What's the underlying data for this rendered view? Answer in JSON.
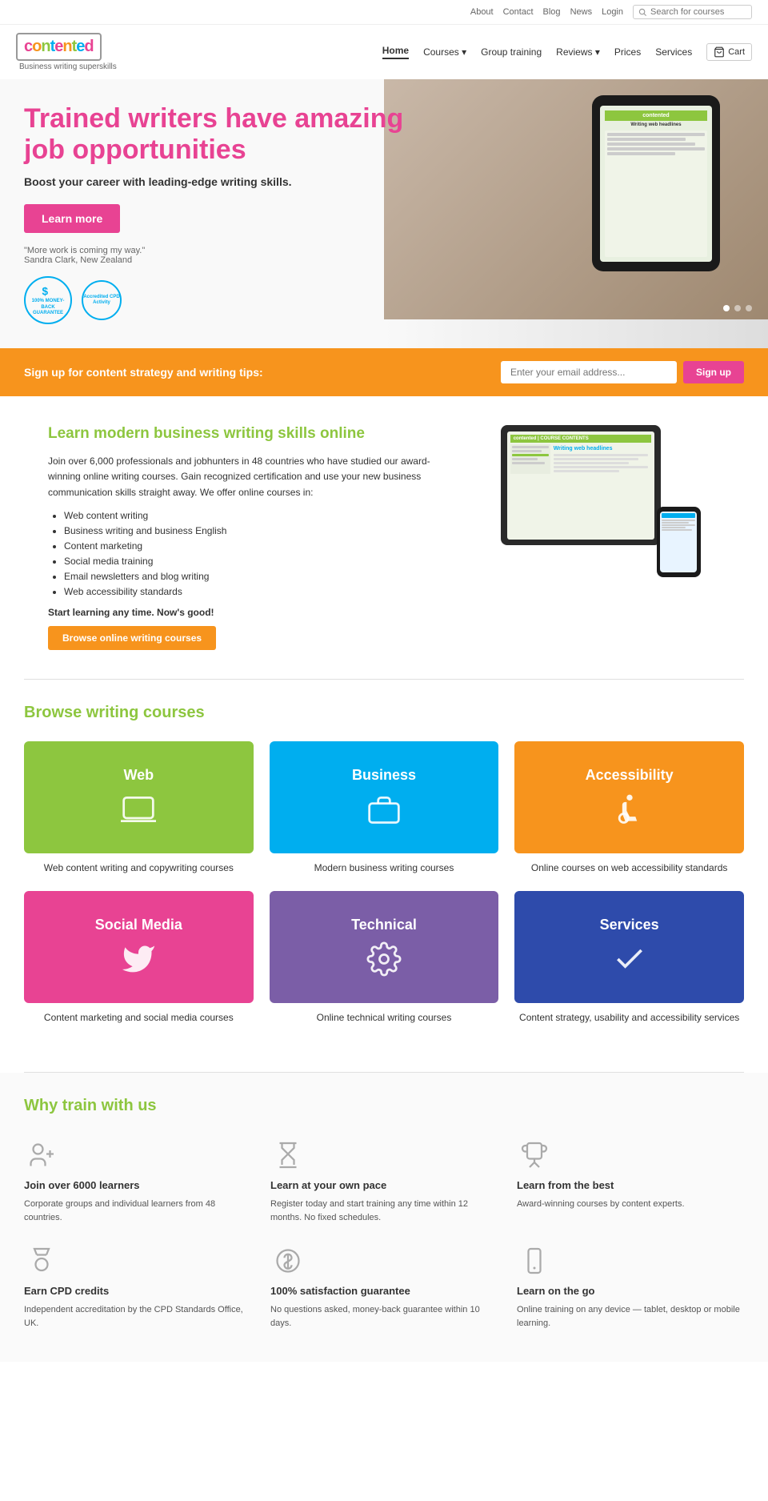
{
  "topBar": {
    "links": [
      "About",
      "Contact",
      "Blog",
      "News",
      "Login"
    ],
    "search_placeholder": "Search for courses"
  },
  "header": {
    "logo_text": "contented",
    "logo_colors": [
      "c",
      "o",
      "n",
      "t",
      "e",
      "n",
      "t",
      "e",
      "d"
    ],
    "tagline": "Business writing superskills",
    "nav": [
      {
        "label": "Home",
        "active": true
      },
      {
        "label": "Courses ▾",
        "active": false
      },
      {
        "label": "Group training",
        "active": false
      },
      {
        "label": "Reviews ▾",
        "active": false
      },
      {
        "label": "Prices",
        "active": false
      },
      {
        "label": "Services",
        "active": false
      }
    ],
    "cart_label": "Cart"
  },
  "hero": {
    "heading_line1": "Trained writers have amazing",
    "heading_line2": "job opportunities",
    "subtitle": "Boost your career with leading-edge writing skills.",
    "cta_button": "Learn more",
    "quote": "\"More work is coming my way.\"",
    "quote_author": "Sandra Clark, New Zealand",
    "badge_money": "100% MONEY-BACK GUARANTEE",
    "badge_cpd": "Accredited CPD Activity"
  },
  "signup": {
    "text": "Sign up for content strategy and writing tips:",
    "placeholder": "Enter your email address...",
    "button": "Sign up"
  },
  "learn": {
    "heading": "Learn modern business writing skills online",
    "body": "Join over 6,000 professionals and jobhunters in 48 countries who have studied our award-winning online writing courses. Gain recognized certification and use your new business communication skills straight away. We offer online courses in:",
    "bullets": [
      "Web content writing",
      "Business writing and business English",
      "Content marketing",
      "Social media training",
      "Email newsletters and blog writing",
      "Web accessibility standards"
    ],
    "cta_text": "Start learning any time. Now's good!",
    "cta_button": "Browse online writing courses",
    "device_text": "Writing web headlines"
  },
  "browse": {
    "heading": "Browse writing courses",
    "courses": [
      {
        "label": "Web",
        "color_class": "tile-green",
        "description": "Web content writing and copywriting courses",
        "icon": "laptop"
      },
      {
        "label": "Business",
        "color_class": "tile-blue",
        "description": "Modern business writing courses",
        "icon": "briefcase"
      },
      {
        "label": "Accessibility",
        "color_class": "tile-orange",
        "description": "Online courses on web accessibility standards",
        "icon": "wheelchair"
      },
      {
        "label": "Social Media",
        "color_class": "tile-pink",
        "description": "Content marketing and social media courses",
        "icon": "twitter"
      },
      {
        "label": "Technical",
        "color_class": "tile-purple",
        "description": "Online technical writing courses",
        "icon": "gear"
      },
      {
        "label": "Services",
        "color_class": "tile-darkblue",
        "description": "Content strategy, usability and accessibility services",
        "icon": "checkmark"
      }
    ]
  },
  "why": {
    "heading": "Why train with us",
    "items": [
      {
        "title": "Join over 6000 learners",
        "description": "Corporate groups and individual learners from 48 countries.",
        "icon": "person-add"
      },
      {
        "title": "Learn at your own pace",
        "description": "Register today and start training any time within 12 months. No fixed schedules.",
        "icon": "hourglass"
      },
      {
        "title": "Learn from the best",
        "description": "Award-winning courses by content experts.",
        "icon": "trophy"
      },
      {
        "title": "Earn CPD credits",
        "description": "Independent accreditation by the CPD Standards Office, UK.",
        "icon": "medal"
      },
      {
        "title": "100% satisfaction guarantee",
        "description": "No questions asked, money-back guarantee within 10 days.",
        "icon": "dollar"
      },
      {
        "title": "Learn on the go",
        "description": "Online training on any device — tablet, desktop or mobile learning.",
        "icon": "mobile"
      }
    ]
  }
}
